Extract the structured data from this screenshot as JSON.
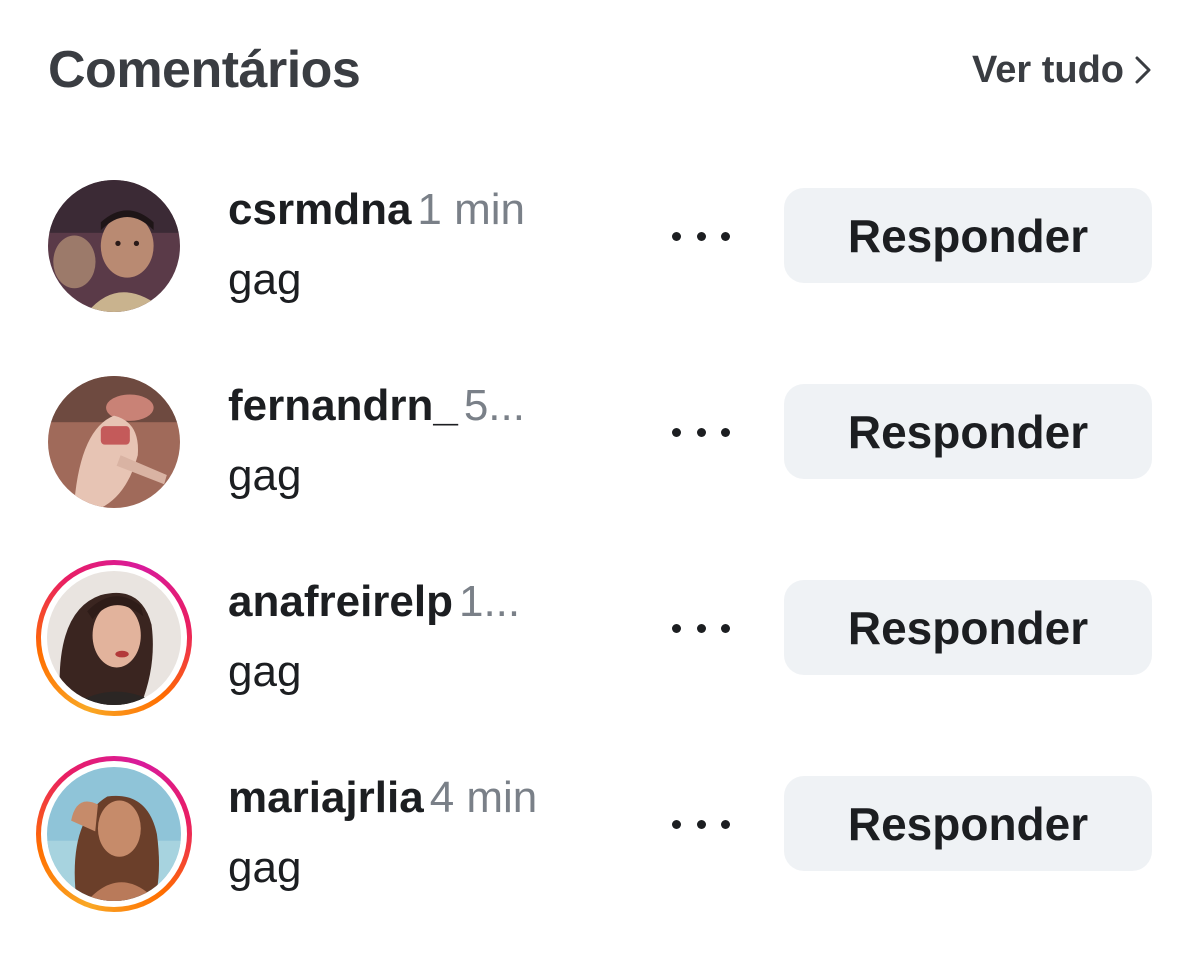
{
  "header": {
    "title": "Comentários",
    "see_all_label": "Ver tudo",
    "see_all_icon": "chevron-right-icon"
  },
  "comments": [
    {
      "username": "csrmdna",
      "time": "1 min",
      "text": "gag",
      "more_icon": "more-dots-icon",
      "reply_label": "Responder",
      "story_ring": false
    },
    {
      "username": "fernandrn_",
      "time": "5...",
      "text": "gag",
      "more_icon": "more-dots-icon",
      "reply_label": "Responder",
      "story_ring": false
    },
    {
      "username": "anafreirelp",
      "time": "1...",
      "text": "gag",
      "more_icon": "more-dots-icon",
      "reply_label": "Responder",
      "story_ring": true
    },
    {
      "username": "mariajrlia",
      "time": "4 min",
      "text": "gag",
      "more_icon": "more-dots-icon",
      "reply_label": "Responder",
      "story_ring": true
    }
  ],
  "colors": {
    "title": "#3a3d42",
    "text": "#1c1e21",
    "muted": "#7a8088",
    "button_bg": "#eff2f5",
    "ring_start": "#f9a825",
    "ring_end": "#d81b9c"
  }
}
